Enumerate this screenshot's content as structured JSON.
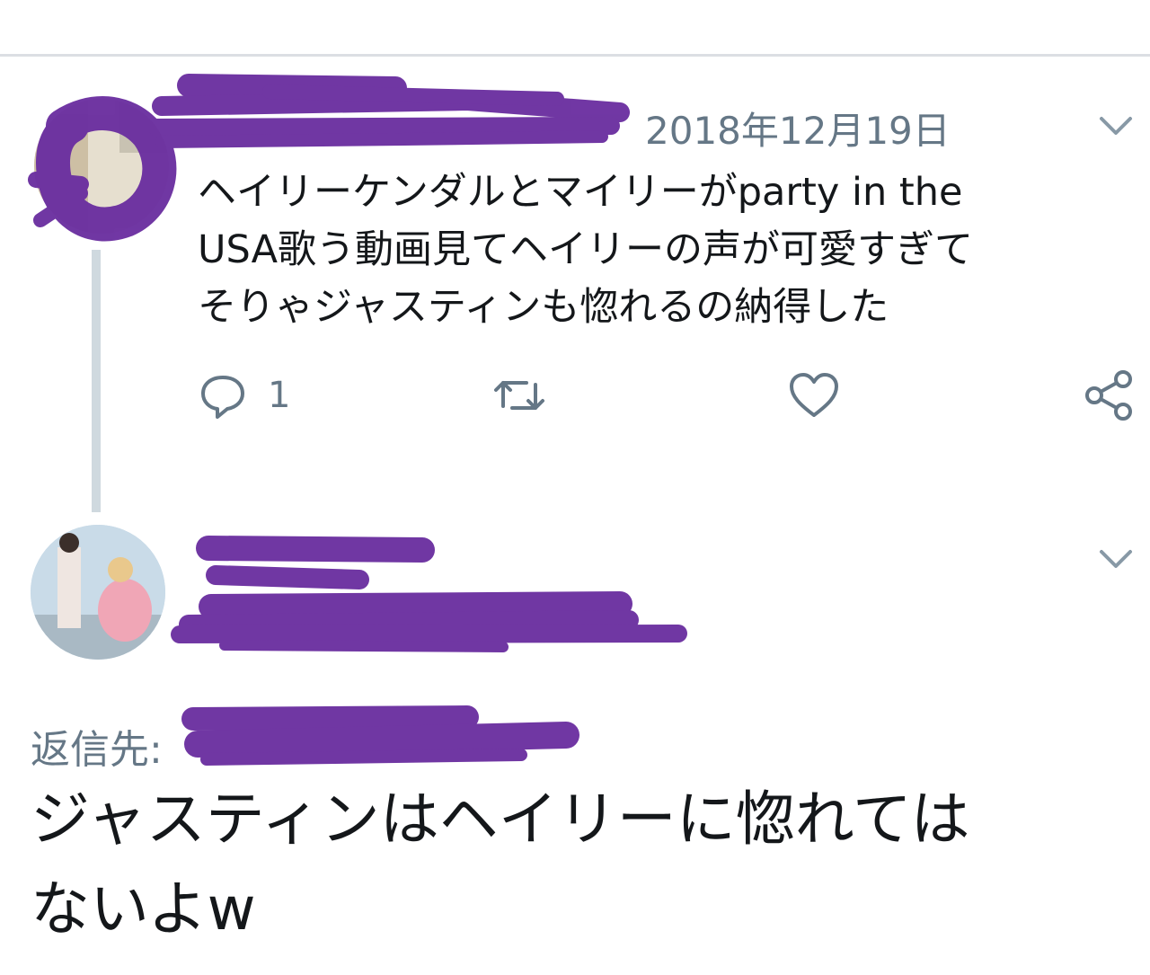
{
  "first_tweet": {
    "timestamp": "2018年12月19日",
    "text": "ヘイリーケンダルとマイリーがparty in the\nUSA歌う動画見てヘイリーの声が可愛すぎて\nそりゃジャスティンも惚れるの納得した",
    "actions": {
      "reply_count": "1"
    }
  },
  "second_tweet": {
    "reply_to_label": "返信先:",
    "text": "ジャスティンはヘイリーに惚れては\nないよw"
  },
  "icons": {
    "menu": "chevron-down-icon",
    "reply": "reply-icon",
    "retweet": "retweet-icon",
    "like": "heart-icon",
    "share": "share-icon"
  },
  "colors": {
    "redaction": "#6b2fa0",
    "muted_text": "#657786",
    "link": "#1da1f2",
    "thread_line": "#cfd9df"
  }
}
